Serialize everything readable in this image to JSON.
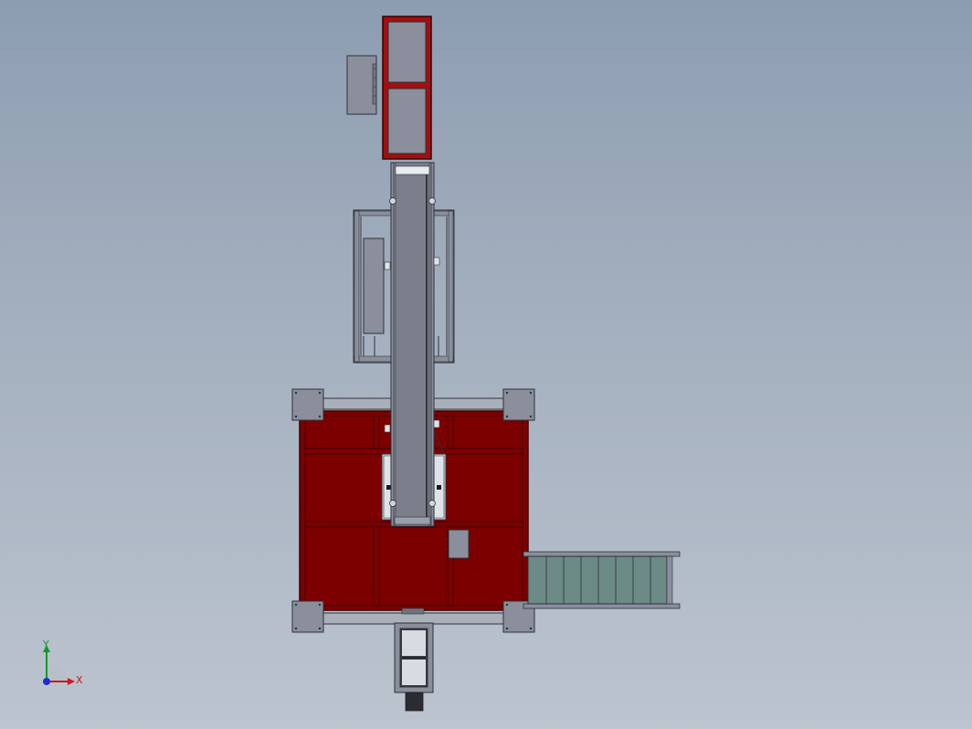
{
  "viewport": {
    "background_top": "#8d9db1",
    "background_bottom": "#bcc4cf"
  },
  "colors": {
    "frame_red": "#7c0000",
    "frame_red_edge": "#3a0000",
    "steel": "#8a8f9b",
    "steel_light": "#aab0ba",
    "steel_edge": "#2e3138",
    "panel_glass": "#a7adb8",
    "conveyor_green": "#6c8a86",
    "axis_x": "#d01818",
    "axis_y": "#0e9a2a",
    "axis_z": "#1a2fd0"
  },
  "triad": {
    "x_label": "X",
    "y_label": "Y"
  },
  "icons": [
    "coordinate-triad-icon"
  ]
}
